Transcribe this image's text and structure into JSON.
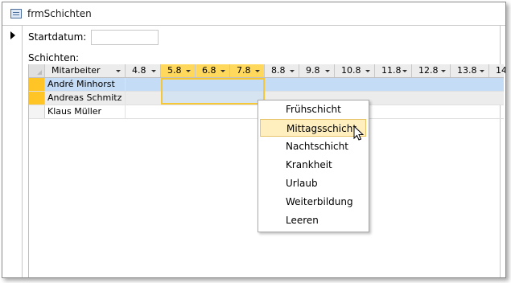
{
  "window": {
    "title": "frmSchichten"
  },
  "form": {
    "startdatum_label": "Startdatum:",
    "startdatum_value": "",
    "schichten_label": "Schichten:"
  },
  "grid": {
    "columns": [
      "Mitarbeiter",
      "4.8",
      "5.8",
      "6.8",
      "7.8",
      "8.8",
      "9.8",
      "10.8",
      "11.8",
      "12.8",
      "13.8",
      "14"
    ],
    "selected_columns": [
      "5.8",
      "6.8",
      "7.8"
    ],
    "rows": [
      {
        "name": "André Minhorst"
      },
      {
        "name": "Andreas Schmitz"
      },
      {
        "name": "Klaus Müller"
      }
    ]
  },
  "context_menu": {
    "items": [
      "Frühschicht",
      "Mittagsschicht",
      "Nachtschicht",
      "Krankheit",
      "Urlaub",
      "Weiterbildung",
      "Leeren"
    ],
    "hovered": "Mittagsschicht"
  },
  "colors": {
    "selection_header": "#ffd85c",
    "row_highlight": "#c5dcf6",
    "menu_hover": "#ffefbf"
  }
}
